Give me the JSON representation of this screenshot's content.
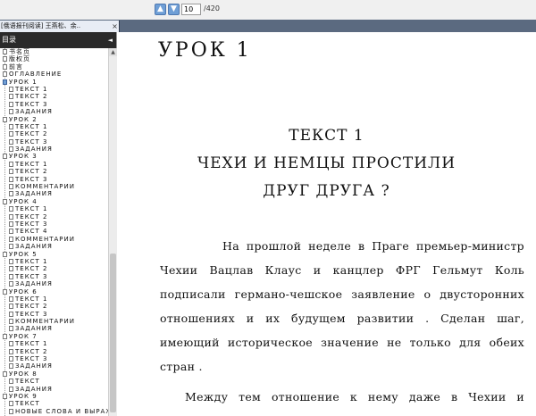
{
  "toolbar": {
    "page_current": "10",
    "page_total": "/420"
  },
  "tab": {
    "label": "[俄语报刊阅读] 王燕松、余..",
    "close": "×"
  },
  "sidebar": {
    "header": "目录",
    "collapse": "◄",
    "items": [
      {
        "label": "书名页",
        "level": 1
      },
      {
        "label": "版权页",
        "level": 1
      },
      {
        "label": "前言",
        "level": 1
      },
      {
        "label": "ОГЛАВЛЕНИЕ",
        "level": 1
      },
      {
        "label": "УРОК 1",
        "level": 1,
        "selected": true
      },
      {
        "label": "ТЕКСТ 1",
        "level": 2
      },
      {
        "label": "ТЕКСТ 2",
        "level": 2
      },
      {
        "label": "ТЕКСТ 3",
        "level": 2
      },
      {
        "label": "ЗАДАНИЯ",
        "level": 2
      },
      {
        "label": "УРОК 2",
        "level": 1
      },
      {
        "label": "ТЕКСТ 1",
        "level": 2
      },
      {
        "label": "ТЕКСТ 2",
        "level": 2
      },
      {
        "label": "ТЕКСТ 3",
        "level": 2
      },
      {
        "label": "ЗАДАНИЯ",
        "level": 2
      },
      {
        "label": "УРОК 3",
        "level": 1
      },
      {
        "label": "ТЕКСТ 1",
        "level": 2
      },
      {
        "label": "ТЕКСТ 2",
        "level": 2
      },
      {
        "label": "ТЕКСТ 3",
        "level": 2
      },
      {
        "label": "КОММЕНТАРИИ",
        "level": 2
      },
      {
        "label": "ЗАДАНИЯ",
        "level": 2
      },
      {
        "label": "УРОК 4",
        "level": 1
      },
      {
        "label": "ТЕКСТ 1",
        "level": 2
      },
      {
        "label": "ТЕКСТ 2",
        "level": 2
      },
      {
        "label": "ТЕКСТ 3",
        "level": 2
      },
      {
        "label": "ТЕКСТ 4",
        "level": 2
      },
      {
        "label": "КОММЕНТАРИИ",
        "level": 2
      },
      {
        "label": "ЗАДАНИЯ",
        "level": 2
      },
      {
        "label": "УРОК 5",
        "level": 1
      },
      {
        "label": "ТЕКСТ 1",
        "level": 2
      },
      {
        "label": "ТЕКСТ 2",
        "level": 2
      },
      {
        "label": "ТЕКСТ 3",
        "level": 2
      },
      {
        "label": "ЗАДАНИЯ",
        "level": 2
      },
      {
        "label": "УРОК 6",
        "level": 1
      },
      {
        "label": "ТЕКСТ 1",
        "level": 2
      },
      {
        "label": "ТЕКСТ 2",
        "level": 2
      },
      {
        "label": "ТЕКСТ 3",
        "level": 2
      },
      {
        "label": "КОММЕНТАРИИ",
        "level": 2
      },
      {
        "label": "ЗАДАНИЯ",
        "level": 2
      },
      {
        "label": "УРОК 7",
        "level": 1
      },
      {
        "label": "ТЕКСТ 1",
        "level": 2
      },
      {
        "label": "ТЕКСТ 2",
        "level": 2
      },
      {
        "label": "ТЕКСТ 3",
        "level": 2
      },
      {
        "label": "ЗАДАНИЯ",
        "level": 2
      },
      {
        "label": "УРОК 8",
        "level": 1
      },
      {
        "label": "ТЕКСТ",
        "level": 2
      },
      {
        "label": "ЗАДАНИЯ",
        "level": 2
      },
      {
        "label": "УРОК 9",
        "level": 1
      },
      {
        "label": "ТЕКСТ",
        "level": 2
      },
      {
        "label": "НОВЫЕ СЛОВА И ВЫРАЖЕНИЯ",
        "level": 2
      }
    ]
  },
  "document": {
    "lesson_title": "УРОК 1",
    "text_heading": "ТЕКСТ 1",
    "article_title_line1": "ЧЕХИ И НЕМЦЫ ПРОСТИЛИ",
    "article_title_line2": "ДРУГ ДРУГА ?",
    "paragraph1": "На прошлой неделе в Праге премьер-министр Чехии Вацлав Клаус и канцлер ФРГ Гельмут Коль подписали германо-чешское заявление о двусторонних отношениях и их будущем развитии . Сделан шаг, имеющий историческое значение не только для обеих стран .",
    "paragraph2": "Между тем отношение к нему даже в Чехии и Германии далеко неоднозначно. В стране, где"
  },
  "colors": {
    "tab_strip": "#5b6a80",
    "sidebar_header": "#2a2a2a",
    "nav_button": "#6f9fd6"
  }
}
